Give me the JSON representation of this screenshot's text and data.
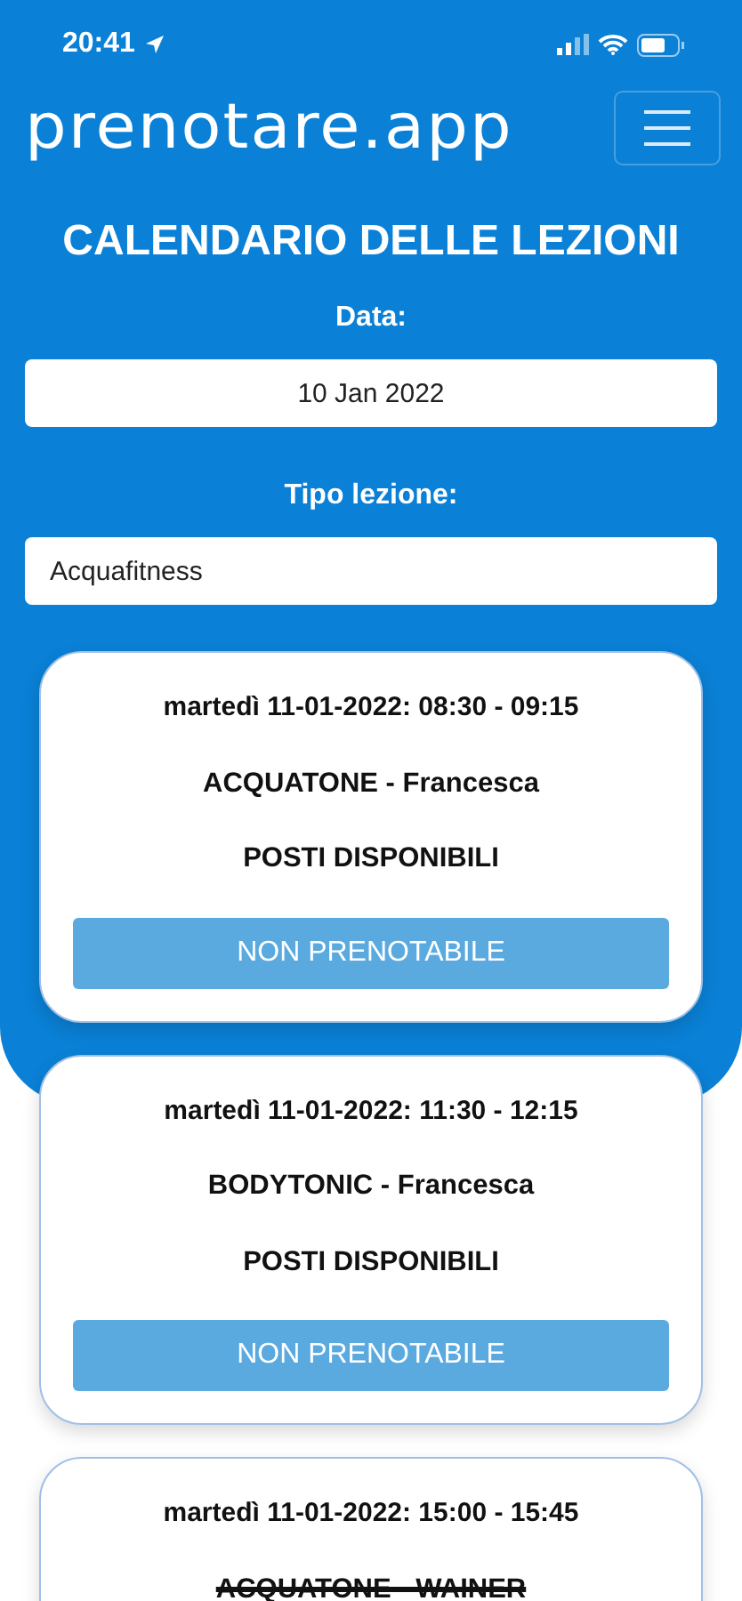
{
  "status_bar": {
    "time": "20:41"
  },
  "header": {
    "logo": "prenotare.app"
  },
  "title": "CALENDARIO DELLE LEZIONI",
  "fields": [
    {
      "kind": "date",
      "label": "Data:",
      "value": "10 Jan 2022"
    },
    {
      "kind": "select",
      "label": "Tipo lezione:",
      "value": "Acquafitness"
    }
  ],
  "lessons": [
    {
      "datetime": "martedì 11-01-2022: 08:30 - 09:15",
      "name": "ACQUATONE - Francesca",
      "availability": "POSTI DISPONIBILI",
      "button": "NON PRENOTABILE",
      "cancelled": false
    },
    {
      "datetime": "martedì 11-01-2022: 11:30 - 12:15",
      "name": "BODYTONIC - Francesca",
      "availability": "POSTI DISPONIBILI",
      "button": "NON PRENOTABILE",
      "cancelled": false
    },
    {
      "datetime": "martedì 11-01-2022: 15:00 - 15:45",
      "name": "ACQUATONE - WAINER",
      "cancelled": true
    }
  ]
}
